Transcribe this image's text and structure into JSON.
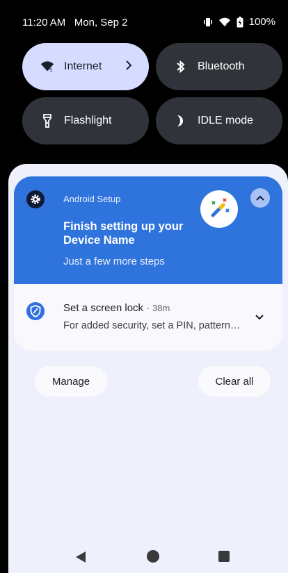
{
  "status_bar": {
    "time": "11:20 AM",
    "date": "Mon, Sep 2",
    "battery": "100%",
    "icons": [
      "vibrate-icon",
      "wifi-icon",
      "battery-icon"
    ]
  },
  "quick_settings": {
    "tiles": [
      {
        "label": "Internet",
        "icon": "wifi-icon",
        "state": "on"
      },
      {
        "label": "Bluetooth",
        "icon": "bluetooth-icon",
        "state": "off"
      },
      {
        "label": "Flashlight",
        "icon": "flashlight-icon",
        "state": "off"
      },
      {
        "label": "IDLE mode",
        "icon": "moon-icon",
        "state": "off"
      }
    ]
  },
  "notifications": {
    "primary": {
      "app_name": "Android Setup",
      "title": "Finish setting up your Device Name",
      "text": "Just a few more steps"
    },
    "secondary": {
      "title": "Set a screen lock",
      "separator": "·",
      "time": "38m",
      "text": "For added security, set a PIN, pattern, or password"
    }
  },
  "actions": {
    "manage_label": "Manage",
    "clear_all_label": "Clear all"
  },
  "colors": {
    "primary_notification": "#2f74dc",
    "tile_on": "#d5dcff",
    "tile_off": "#30343a",
    "shade": "#eef0fb"
  }
}
